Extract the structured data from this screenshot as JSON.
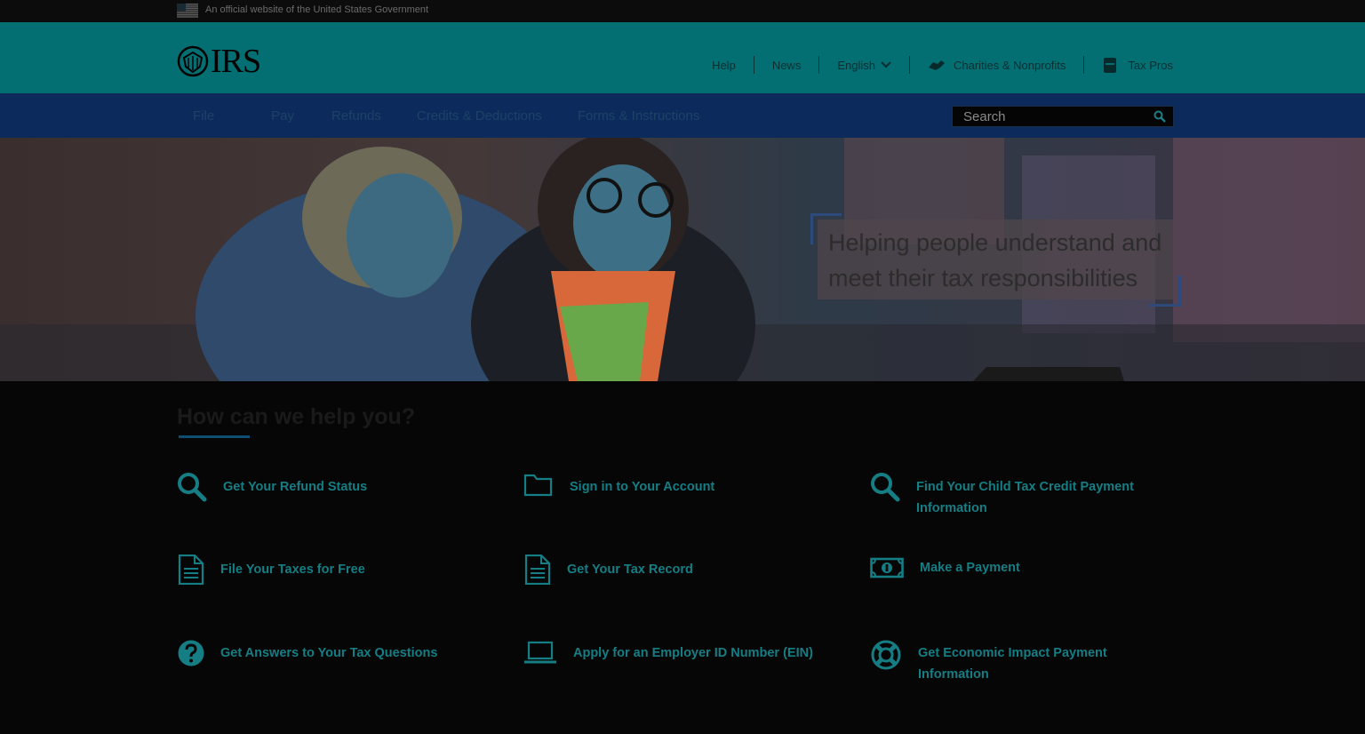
{
  "gov_banner": {
    "text": "An official website of the United States Government"
  },
  "header": {
    "logo_text": "IRS",
    "utility_links": [
      {
        "label": "Help"
      },
      {
        "label": "News"
      },
      {
        "label": "English"
      },
      {
        "label": "Charities & Nonprofits"
      },
      {
        "label": "Tax Pros"
      }
    ]
  },
  "nav": {
    "items": [
      {
        "label": "File"
      },
      {
        "label": "Pay"
      },
      {
        "label": "Refunds"
      },
      {
        "label": "Credits & Deductions"
      },
      {
        "label": "Forms & Instructions"
      }
    ],
    "search_placeholder": "Search"
  },
  "hero": {
    "tagline": "Helping people understand and meet their tax responsibilities"
  },
  "help": {
    "title": "How can we help you?",
    "tasks": [
      {
        "label": "Get Your Refund Status",
        "icon": "search-icon"
      },
      {
        "label": "Sign in to Your Account",
        "icon": "folder-icon"
      },
      {
        "label": "Find Your Child Tax Credit Payment Information",
        "icon": "search-icon"
      },
      {
        "label": "File Your Taxes for Free",
        "icon": "document-icon"
      },
      {
        "label": "Get Your Tax Record",
        "icon": "document-icon"
      },
      {
        "label": "Make a Payment",
        "icon": "money-icon"
      },
      {
        "label": "Get Answers to Your Tax Questions",
        "icon": "question-icon"
      },
      {
        "label": "Apply for an Employer ID Number (EIN)",
        "icon": "laptop-icon"
      },
      {
        "label": "Get Economic Impact Payment Information",
        "icon": "lifebuoy-icon"
      }
    ]
  },
  "colors": {
    "header_bg": "#036f73",
    "nav_bg": "#0c2b5c",
    "link_teal": "#157e84",
    "page_bg": "#060606"
  }
}
